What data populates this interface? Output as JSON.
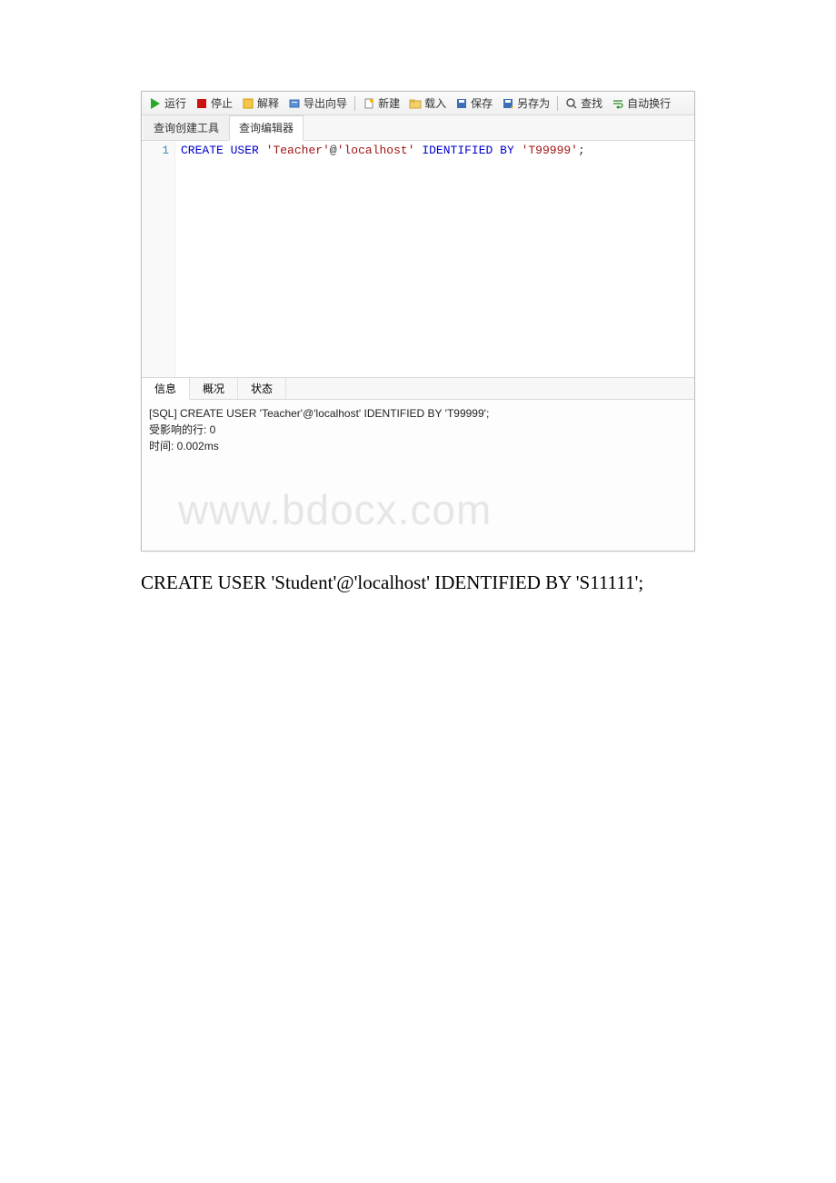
{
  "toolbar": {
    "run": "运行",
    "stop": "停止",
    "explain": "解释",
    "export_wizard": "导出向导",
    "new": "新建",
    "load": "载入",
    "save": "保存",
    "save_as": "另存为",
    "find": "查找",
    "wrap": "自动换行"
  },
  "tabs": {
    "query_builder": "查询创建工具",
    "query_editor": "查询编辑器"
  },
  "editor": {
    "line_number": "1",
    "kw_create": "CREATE",
    "kw_user": "USER",
    "str_teacher": "'Teacher'",
    "at": "@",
    "str_localhost": "'localhost'",
    "kw_identified": "IDENTIFIED",
    "kw_by": "BY",
    "str_pwd": "'T99999'",
    "semi": ";"
  },
  "result_tabs": {
    "info": "信息",
    "profile": "概况",
    "status": "状态"
  },
  "output": {
    "sql_line": "[SQL] CREATE USER 'Teacher'@'localhost' IDENTIFIED BY 'T99999';",
    "affected": "受影响的行: 0",
    "time": "时间: 0.002ms"
  },
  "watermark": "www.bdocx.com",
  "doc_text": "CREATE USER 'Student'@'localhost' IDENTIFIED BY 'S11111';"
}
